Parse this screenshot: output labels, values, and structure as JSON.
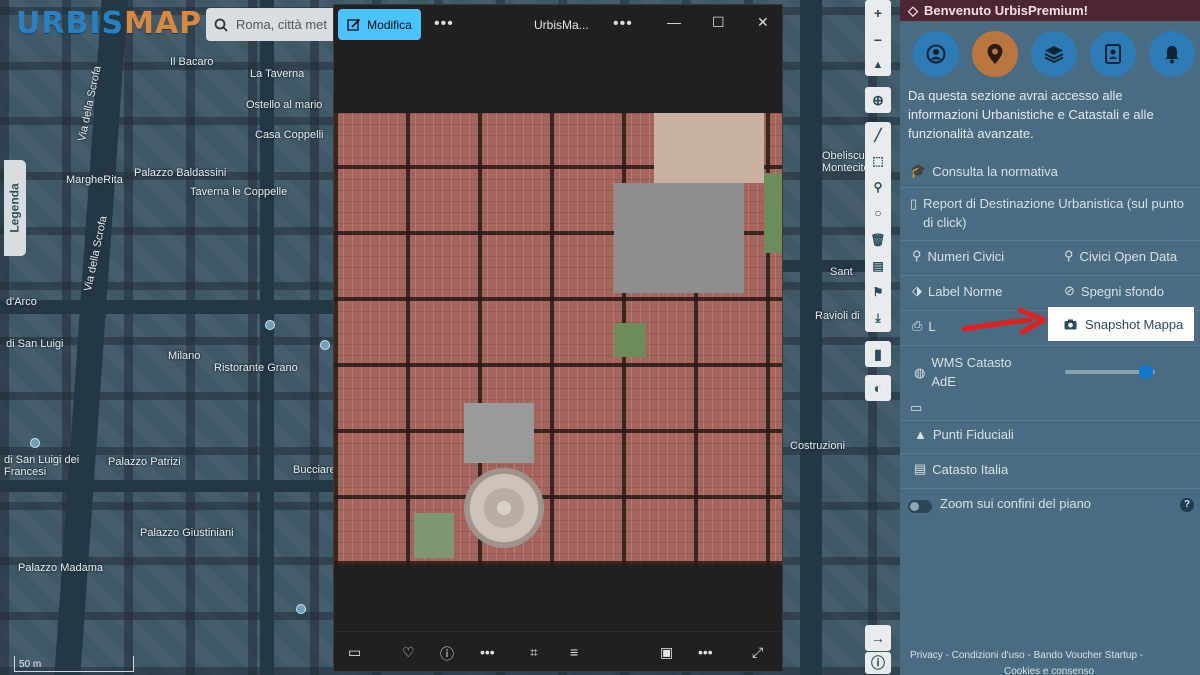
{
  "map": {
    "logo_part1": "URBIS",
    "logo_part2": "MAP",
    "search_placeholder": "Roma, città met",
    "legend_tab": "Legenda",
    "scale_label": "50 m",
    "street_labels": [
      "Via della Scrofa",
      "Via della Scrofa",
      "MargheRita",
      "Palazzo Baldassini",
      "Taverna le Coppelle",
      "Il Bacaro",
      "La Taverna",
      "Ostello al mario",
      "Casa Coppelli",
      "d'Arco",
      "di San Luigi",
      "Milano",
      "Ristorante Grano",
      "di San Luigi dei Francesi",
      "Palazzo Patrizi",
      "Palazzo Giustiniani",
      "Palazzo Madama",
      "Bucciarelli",
      "Obeliscus Montecitorio",
      "Ravioli di",
      "Costruzioni",
      "Sant"
    ]
  },
  "viewer": {
    "edit_label": "Modifica",
    "title": "UrbisMa...",
    "menu_dots": "•••"
  },
  "panel": {
    "header": "Benvenuto UrbisPremium!",
    "description": "Da questa sezione avrai accesso alle informazioni Urbanistiche e Catastali e alle funzionalità avanzate.",
    "items": {
      "consulta": "Consulta la normativa",
      "report": "Report di Destinazione Urbanistica (sul punto di click)",
      "numeri_civici": "Numeri Civici",
      "civici_open": "Civici Open Data",
      "label_norme": "Label Norme",
      "spegni_sfondo": "Spegni sfondo",
      "print_label": "L",
      "snapshot": "Snapshot Mappa",
      "wms": "WMS Catasto AdE",
      "punti_fiduciali": "Punti Fiduciali",
      "catasto_italia": "Catasto Italia",
      "zoom_confini": "Zoom sui confini del piano"
    },
    "slider_value": 0.9,
    "footer_line1": "Privacy - Condizioni d'uso - Bando Voucher Startup -",
    "footer_line2": "Cookies e consenso"
  },
  "colors": {
    "accent_blue": "#2e7bb6",
    "accent_orange": "#b9763f",
    "header_bg": "#4c2630",
    "annotation_red": "#e0201c",
    "viewer_edit": "#4cc2ff"
  }
}
